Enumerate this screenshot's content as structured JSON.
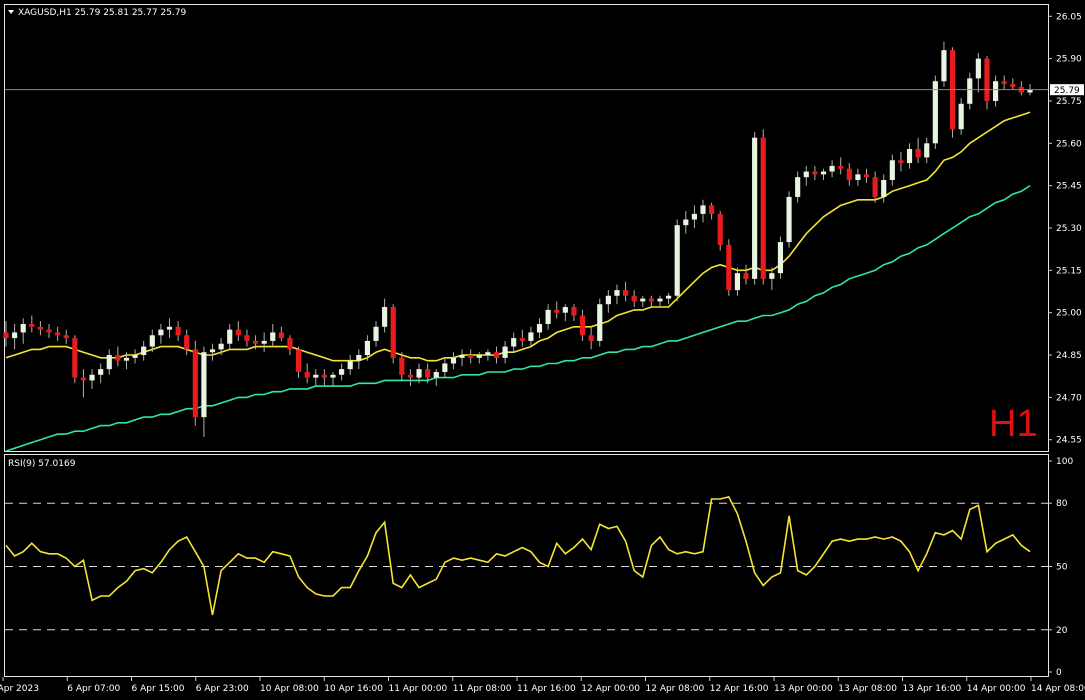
{
  "main_panel": {
    "symbol_header": "XAGUSD,H1  25.79 25.81 25.77 25.79",
    "timeframe_badge": "H1",
    "price_ticks": [
      "26.05",
      "25.90",
      "25.75",
      "25.60",
      "25.45",
      "25.30",
      "25.15",
      "25.00",
      "24.85",
      "24.70",
      "24.55"
    ],
    "current_price_label": "25.79"
  },
  "rsi_panel": {
    "header": "RSI(9) 57.0169",
    "ticks": [
      "100",
      "80",
      "50",
      "20",
      "0"
    ]
  },
  "time_ticks": [
    "5 Apr 2023",
    "6 Apr 07:00",
    "6 Apr 15:00",
    "6 Apr 23:00",
    "10 Apr 08:00",
    "10 Apr 16:00",
    "11 Apr 00:00",
    "11 Apr 08:00",
    "11 Apr 16:00",
    "12 Apr 00:00",
    "12 Apr 08:00",
    "12 Apr 16:00",
    "13 Apr 00:00",
    "13 Apr 08:00",
    "13 Apr 16:00",
    "14 Apr 00:00",
    "14 Apr 08:00"
  ],
  "colors": {
    "background": "#000000",
    "bull_candle": "#e8f5e0",
    "bear_candle": "#e81c1c",
    "wick": "#b0b0b0",
    "ma_fast": "#f5e432",
    "ma_slow": "#2ee8a0",
    "rsi_line": "#f5e432",
    "timeframe_badge": "#e01010"
  },
  "chart_data": [
    {
      "type": "candlestick",
      "title": "XAGUSD,H1",
      "ohlc_header": {
        "open": 25.79,
        "high": 25.81,
        "low": 25.77,
        "close": 25.79
      },
      "ylim": [
        24.51,
        26.09
      ],
      "y_ticks": [
        26.05,
        25.9,
        25.75,
        25.6,
        25.45,
        25.3,
        25.15,
        25.0,
        24.85,
        24.7,
        24.55
      ],
      "current_price": 25.79,
      "bar_count": 120,
      "candles": [
        {
          "o": 24.93,
          "h": 24.97,
          "l": 24.88,
          "c": 24.91
        },
        {
          "o": 24.91,
          "h": 24.96,
          "l": 24.87,
          "c": 24.93
        },
        {
          "o": 24.93,
          "h": 24.98,
          "l": 24.89,
          "c": 24.96
        },
        {
          "o": 24.96,
          "h": 24.99,
          "l": 24.93,
          "c": 24.95
        },
        {
          "o": 24.95,
          "h": 24.97,
          "l": 24.92,
          "c": 24.94
        },
        {
          "o": 24.94,
          "h": 24.96,
          "l": 24.91,
          "c": 24.93
        },
        {
          "o": 24.93,
          "h": 24.95,
          "l": 24.9,
          "c": 24.92
        },
        {
          "o": 24.92,
          "h": 24.94,
          "l": 24.89,
          "c": 24.91
        },
        {
          "o": 24.91,
          "h": 24.92,
          "l": 24.75,
          "c": 24.77
        },
        {
          "o": 24.77,
          "h": 24.8,
          "l": 24.7,
          "c": 24.76
        },
        {
          "o": 24.76,
          "h": 24.8,
          "l": 24.73,
          "c": 24.78
        },
        {
          "o": 24.78,
          "h": 24.82,
          "l": 24.75,
          "c": 24.8
        },
        {
          "o": 24.8,
          "h": 24.87,
          "l": 24.78,
          "c": 24.85
        },
        {
          "o": 24.85,
          "h": 24.88,
          "l": 24.81,
          "c": 24.83
        },
        {
          "o": 24.83,
          "h": 24.86,
          "l": 24.8,
          "c": 24.84
        },
        {
          "o": 24.84,
          "h": 24.87,
          "l": 24.82,
          "c": 24.85
        },
        {
          "o": 24.85,
          "h": 24.9,
          "l": 24.83,
          "c": 24.88
        },
        {
          "o": 24.88,
          "h": 24.94,
          "l": 24.86,
          "c": 24.92
        },
        {
          "o": 24.92,
          "h": 24.96,
          "l": 24.89,
          "c": 24.94
        },
        {
          "o": 24.94,
          "h": 24.98,
          "l": 24.91,
          "c": 24.95
        },
        {
          "o": 24.95,
          "h": 24.97,
          "l": 24.9,
          "c": 24.92
        },
        {
          "o": 24.92,
          "h": 24.94,
          "l": 24.85,
          "c": 24.87
        },
        {
          "o": 24.87,
          "h": 24.9,
          "l": 24.6,
          "c": 24.63
        },
        {
          "o": 24.63,
          "h": 24.88,
          "l": 24.56,
          "c": 24.86
        },
        {
          "o": 24.86,
          "h": 24.89,
          "l": 24.83,
          "c": 24.87
        },
        {
          "o": 24.87,
          "h": 24.91,
          "l": 24.85,
          "c": 24.89
        },
        {
          "o": 24.89,
          "h": 24.96,
          "l": 24.87,
          "c": 24.94
        },
        {
          "o": 24.94,
          "h": 24.97,
          "l": 24.9,
          "c": 24.92
        },
        {
          "o": 24.92,
          "h": 24.94,
          "l": 24.88,
          "c": 24.9
        },
        {
          "o": 24.9,
          "h": 24.92,
          "l": 24.87,
          "c": 24.89
        },
        {
          "o": 24.89,
          "h": 24.93,
          "l": 24.86,
          "c": 24.9
        },
        {
          "o": 24.9,
          "h": 24.96,
          "l": 24.88,
          "c": 24.93
        },
        {
          "o": 24.93,
          "h": 24.95,
          "l": 24.9,
          "c": 24.91
        },
        {
          "o": 24.91,
          "h": 24.92,
          "l": 24.85,
          "c": 24.87
        },
        {
          "o": 24.87,
          "h": 24.88,
          "l": 24.77,
          "c": 24.79
        },
        {
          "o": 24.79,
          "h": 24.82,
          "l": 24.75,
          "c": 24.77
        },
        {
          "o": 24.77,
          "h": 24.8,
          "l": 24.74,
          "c": 24.78
        },
        {
          "o": 24.78,
          "h": 24.8,
          "l": 24.74,
          "c": 24.77
        },
        {
          "o": 24.77,
          "h": 24.79,
          "l": 24.74,
          "c": 24.78
        },
        {
          "o": 24.78,
          "h": 24.82,
          "l": 24.76,
          "c": 24.8
        },
        {
          "o": 24.8,
          "h": 24.85,
          "l": 24.78,
          "c": 24.83
        },
        {
          "o": 24.83,
          "h": 24.87,
          "l": 24.8,
          "c": 24.85
        },
        {
          "o": 24.85,
          "h": 24.92,
          "l": 24.83,
          "c": 24.9
        },
        {
          "o": 24.9,
          "h": 24.97,
          "l": 24.88,
          "c": 24.95
        },
        {
          "o": 24.95,
          "h": 25.05,
          "l": 24.93,
          "c": 25.02
        },
        {
          "o": 25.02,
          "h": 25.03,
          "l": 24.82,
          "c": 24.84
        },
        {
          "o": 24.84,
          "h": 24.86,
          "l": 24.76,
          "c": 24.78
        },
        {
          "o": 24.78,
          "h": 24.8,
          "l": 24.74,
          "c": 24.77
        },
        {
          "o": 24.77,
          "h": 24.82,
          "l": 24.75,
          "c": 24.8
        },
        {
          "o": 24.8,
          "h": 24.82,
          "l": 24.75,
          "c": 24.77
        },
        {
          "o": 24.77,
          "h": 24.8,
          "l": 24.74,
          "c": 24.79
        },
        {
          "o": 24.79,
          "h": 24.84,
          "l": 24.77,
          "c": 24.82
        },
        {
          "o": 24.82,
          "h": 24.86,
          "l": 24.8,
          "c": 24.84
        },
        {
          "o": 24.84,
          "h": 24.87,
          "l": 24.81,
          "c": 24.85
        },
        {
          "o": 24.85,
          "h": 24.87,
          "l": 24.82,
          "c": 24.84
        },
        {
          "o": 24.84,
          "h": 24.86,
          "l": 24.82,
          "c": 24.85
        },
        {
          "o": 24.85,
          "h": 24.87,
          "l": 24.83,
          "c": 24.86
        },
        {
          "o": 24.86,
          "h": 24.88,
          "l": 24.82,
          "c": 24.84
        },
        {
          "o": 24.84,
          "h": 24.9,
          "l": 24.82,
          "c": 24.88
        },
        {
          "o": 24.88,
          "h": 24.93,
          "l": 24.86,
          "c": 24.91
        },
        {
          "o": 24.91,
          "h": 24.94,
          "l": 24.88,
          "c": 24.9
        },
        {
          "o": 24.9,
          "h": 24.95,
          "l": 24.88,
          "c": 24.93
        },
        {
          "o": 24.93,
          "h": 24.98,
          "l": 24.91,
          "c": 24.96
        },
        {
          "o": 24.96,
          "h": 25.03,
          "l": 24.94,
          "c": 25.01
        },
        {
          "o": 25.01,
          "h": 25.04,
          "l": 24.98,
          "c": 25.0
        },
        {
          "o": 25.0,
          "h": 25.03,
          "l": 24.97,
          "c": 25.02
        },
        {
          "o": 25.02,
          "h": 25.03,
          "l": 24.97,
          "c": 24.99
        },
        {
          "o": 24.99,
          "h": 25.01,
          "l": 24.9,
          "c": 24.92
        },
        {
          "o": 24.92,
          "h": 24.95,
          "l": 24.87,
          "c": 24.9
        },
        {
          "o": 24.9,
          "h": 25.05,
          "l": 24.88,
          "c": 25.03
        },
        {
          "o": 25.03,
          "h": 25.08,
          "l": 25.0,
          "c": 25.06
        },
        {
          "o": 25.06,
          "h": 25.1,
          "l": 25.03,
          "c": 25.08
        },
        {
          "o": 25.08,
          "h": 25.11,
          "l": 25.04,
          "c": 25.06
        },
        {
          "o": 25.06,
          "h": 25.08,
          "l": 25.02,
          "c": 25.04
        },
        {
          "o": 25.04,
          "h": 25.06,
          "l": 25.02,
          "c": 25.05
        },
        {
          "o": 25.05,
          "h": 25.06,
          "l": 25.02,
          "c": 25.04
        },
        {
          "o": 25.04,
          "h": 25.06,
          "l": 25.02,
          "c": 25.05
        },
        {
          "o": 25.05,
          "h": 25.07,
          "l": 25.03,
          "c": 25.06
        },
        {
          "o": 25.06,
          "h": 25.33,
          "l": 25.04,
          "c": 25.31
        },
        {
          "o": 25.31,
          "h": 25.36,
          "l": 25.28,
          "c": 25.33
        },
        {
          "o": 25.33,
          "h": 25.38,
          "l": 25.3,
          "c": 25.35
        },
        {
          "o": 25.35,
          "h": 25.4,
          "l": 25.32,
          "c": 25.38
        },
        {
          "o": 25.38,
          "h": 25.39,
          "l": 25.33,
          "c": 25.35
        },
        {
          "o": 25.35,
          "h": 25.36,
          "l": 25.22,
          "c": 25.24
        },
        {
          "o": 25.24,
          "h": 25.26,
          "l": 25.06,
          "c": 25.08
        },
        {
          "o": 25.08,
          "h": 25.16,
          "l": 25.06,
          "c": 25.14
        },
        {
          "o": 25.14,
          "h": 25.17,
          "l": 25.1,
          "c": 25.12
        },
        {
          "o": 25.12,
          "h": 25.64,
          "l": 25.1,
          "c": 25.62
        },
        {
          "o": 25.62,
          "h": 25.65,
          "l": 25.1,
          "c": 25.12
        },
        {
          "o": 25.12,
          "h": 25.16,
          "l": 25.08,
          "c": 25.14
        },
        {
          "o": 25.14,
          "h": 25.27,
          "l": 25.12,
          "c": 25.25
        },
        {
          "o": 25.25,
          "h": 25.43,
          "l": 25.23,
          "c": 25.41
        },
        {
          "o": 25.41,
          "h": 25.5,
          "l": 25.39,
          "c": 25.48
        },
        {
          "o": 25.48,
          "h": 25.52,
          "l": 25.45,
          "c": 25.5
        },
        {
          "o": 25.5,
          "h": 25.52,
          "l": 25.47,
          "c": 25.49
        },
        {
          "o": 25.49,
          "h": 25.51,
          "l": 25.47,
          "c": 25.5
        },
        {
          "o": 25.5,
          "h": 25.54,
          "l": 25.48,
          "c": 25.52
        },
        {
          "o": 25.52,
          "h": 25.55,
          "l": 25.49,
          "c": 25.51
        },
        {
          "o": 25.51,
          "h": 25.53,
          "l": 25.45,
          "c": 25.47
        },
        {
          "o": 25.47,
          "h": 25.51,
          "l": 25.45,
          "c": 25.49
        },
        {
          "o": 25.49,
          "h": 25.51,
          "l": 25.46,
          "c": 25.48
        },
        {
          "o": 25.48,
          "h": 25.5,
          "l": 25.39,
          "c": 25.41
        },
        {
          "o": 25.41,
          "h": 25.49,
          "l": 25.39,
          "c": 25.47
        },
        {
          "o": 25.47,
          "h": 25.56,
          "l": 25.45,
          "c": 25.54
        },
        {
          "o": 25.54,
          "h": 25.57,
          "l": 25.5,
          "c": 25.53
        },
        {
          "o": 25.53,
          "h": 25.6,
          "l": 25.51,
          "c": 25.58
        },
        {
          "o": 25.58,
          "h": 25.62,
          "l": 25.53,
          "c": 25.55
        },
        {
          "o": 25.55,
          "h": 25.62,
          "l": 25.53,
          "c": 25.6
        },
        {
          "o": 25.6,
          "h": 25.84,
          "l": 25.58,
          "c": 25.82
        },
        {
          "o": 25.82,
          "h": 25.96,
          "l": 25.8,
          "c": 25.93
        },
        {
          "o": 25.93,
          "h": 25.94,
          "l": 25.62,
          "c": 25.65
        },
        {
          "o": 25.65,
          "h": 25.76,
          "l": 25.63,
          "c": 25.74
        },
        {
          "o": 25.74,
          "h": 25.85,
          "l": 25.72,
          "c": 25.83
        },
        {
          "o": 25.83,
          "h": 25.92,
          "l": 25.78,
          "c": 25.9
        },
        {
          "o": 25.9,
          "h": 25.91,
          "l": 25.72,
          "c": 25.75
        },
        {
          "o": 25.75,
          "h": 25.84,
          "l": 25.73,
          "c": 25.82
        },
        {
          "o": 25.82,
          "h": 25.84,
          "l": 25.79,
          "c": 25.81
        },
        {
          "o": 25.81,
          "h": 25.83,
          "l": 25.79,
          "c": 25.8
        },
        {
          "o": 25.8,
          "h": 25.82,
          "l": 25.77,
          "c": 25.78
        },
        {
          "o": 25.78,
          "h": 25.81,
          "l": 25.77,
          "c": 25.79
        }
      ],
      "ma_fast": [
        24.84,
        24.85,
        24.86,
        24.87,
        24.87,
        24.88,
        24.88,
        24.88,
        24.87,
        24.86,
        24.85,
        24.84,
        24.84,
        24.84,
        24.85,
        24.85,
        24.86,
        24.87,
        24.88,
        24.88,
        24.88,
        24.87,
        24.86,
        24.85,
        24.85,
        24.86,
        24.87,
        24.87,
        24.87,
        24.88,
        24.88,
        24.88,
        24.88,
        24.88,
        24.87,
        24.86,
        24.85,
        24.84,
        24.83,
        24.83,
        24.83,
        24.83,
        24.84,
        24.86,
        24.87,
        24.86,
        24.85,
        24.84,
        24.84,
        24.83,
        24.83,
        24.84,
        24.84,
        24.85,
        24.85,
        24.85,
        24.85,
        24.85,
        24.86,
        24.86,
        24.87,
        24.88,
        24.9,
        24.91,
        24.93,
        24.94,
        24.95,
        24.95,
        24.95,
        24.96,
        24.97,
        24.99,
        25.0,
        25.01,
        25.01,
        25.02,
        25.02,
        25.02,
        25.05,
        25.08,
        25.11,
        25.14,
        25.16,
        25.17,
        25.16,
        25.15,
        25.15,
        25.16,
        25.15,
        25.15,
        25.17,
        25.2,
        25.24,
        25.28,
        25.31,
        25.34,
        25.36,
        25.38,
        25.39,
        25.4,
        25.4,
        25.4,
        25.41,
        25.43,
        25.44,
        25.45,
        25.46,
        25.47,
        25.5,
        25.54,
        25.55,
        25.57,
        25.6,
        25.62,
        25.64,
        25.66,
        25.68,
        25.69,
        25.7,
        25.71
      ],
      "ma_slow": [
        24.51,
        24.52,
        24.53,
        24.54,
        24.55,
        24.56,
        24.57,
        24.57,
        24.58,
        24.58,
        24.59,
        24.6,
        24.6,
        24.61,
        24.61,
        24.62,
        24.63,
        24.63,
        24.64,
        24.64,
        24.65,
        24.66,
        24.66,
        24.67,
        24.67,
        24.68,
        24.69,
        24.7,
        24.7,
        24.71,
        24.71,
        24.72,
        24.72,
        24.73,
        24.73,
        24.73,
        24.74,
        24.74,
        24.74,
        24.74,
        24.74,
        24.75,
        24.75,
        24.75,
        24.76,
        24.76,
        24.76,
        24.76,
        24.76,
        24.76,
        24.77,
        24.77,
        24.77,
        24.78,
        24.78,
        24.78,
        24.79,
        24.79,
        24.79,
        24.8,
        24.8,
        24.81,
        24.81,
        24.82,
        24.82,
        24.83,
        24.83,
        24.84,
        24.84,
        24.85,
        24.86,
        24.86,
        24.87,
        24.87,
        24.88,
        24.88,
        24.89,
        24.9,
        24.9,
        24.91,
        24.92,
        24.93,
        24.94,
        24.95,
        24.96,
        24.97,
        24.97,
        24.98,
        24.99,
        24.99,
        25.0,
        25.01,
        25.03,
        25.04,
        25.06,
        25.07,
        25.09,
        25.1,
        25.12,
        25.13,
        25.14,
        25.15,
        25.17,
        25.18,
        25.2,
        25.21,
        25.23,
        25.24,
        25.26,
        25.28,
        25.3,
        25.32,
        25.34,
        25.35,
        25.37,
        25.39,
        25.4,
        25.42,
        25.43,
        25.45
      ]
    },
    {
      "type": "line",
      "title": "RSI(9)",
      "last_value": 57.0169,
      "ylim": [
        0,
        100
      ],
      "y_ticks": [
        100,
        80,
        50,
        20,
        0
      ],
      "levels": [
        80,
        50,
        20
      ],
      "values": [
        60,
        55,
        57,
        61,
        57,
        56,
        56,
        54,
        50,
        53,
        34,
        36,
        36,
        40,
        43,
        48,
        49,
        47,
        52,
        58,
        62,
        64,
        57,
        50,
        27,
        48,
        52,
        56,
        54,
        54,
        52,
        57,
        56,
        55,
        45,
        40,
        37,
        36,
        36,
        40,
        40,
        48,
        55,
        66,
        71,
        42,
        40,
        46,
        40,
        42,
        44,
        52,
        54,
        53,
        54,
        53,
        52,
        56,
        55,
        57,
        59,
        57,
        52,
        50,
        61,
        56,
        59,
        63,
        58,
        70,
        68,
        69,
        62,
        48,
        45,
        60,
        64,
        58,
        56,
        57,
        56,
        57,
        82,
        82,
        83,
        75,
        62,
        47,
        41,
        45,
        47,
        74,
        48,
        46,
        50,
        56,
        62,
        63,
        62,
        63,
        63,
        64,
        63,
        64,
        62,
        57,
        48,
        56,
        66,
        65,
        67,
        63,
        77,
        79,
        57,
        61,
        63,
        65,
        60,
        57
      ]
    }
  ]
}
